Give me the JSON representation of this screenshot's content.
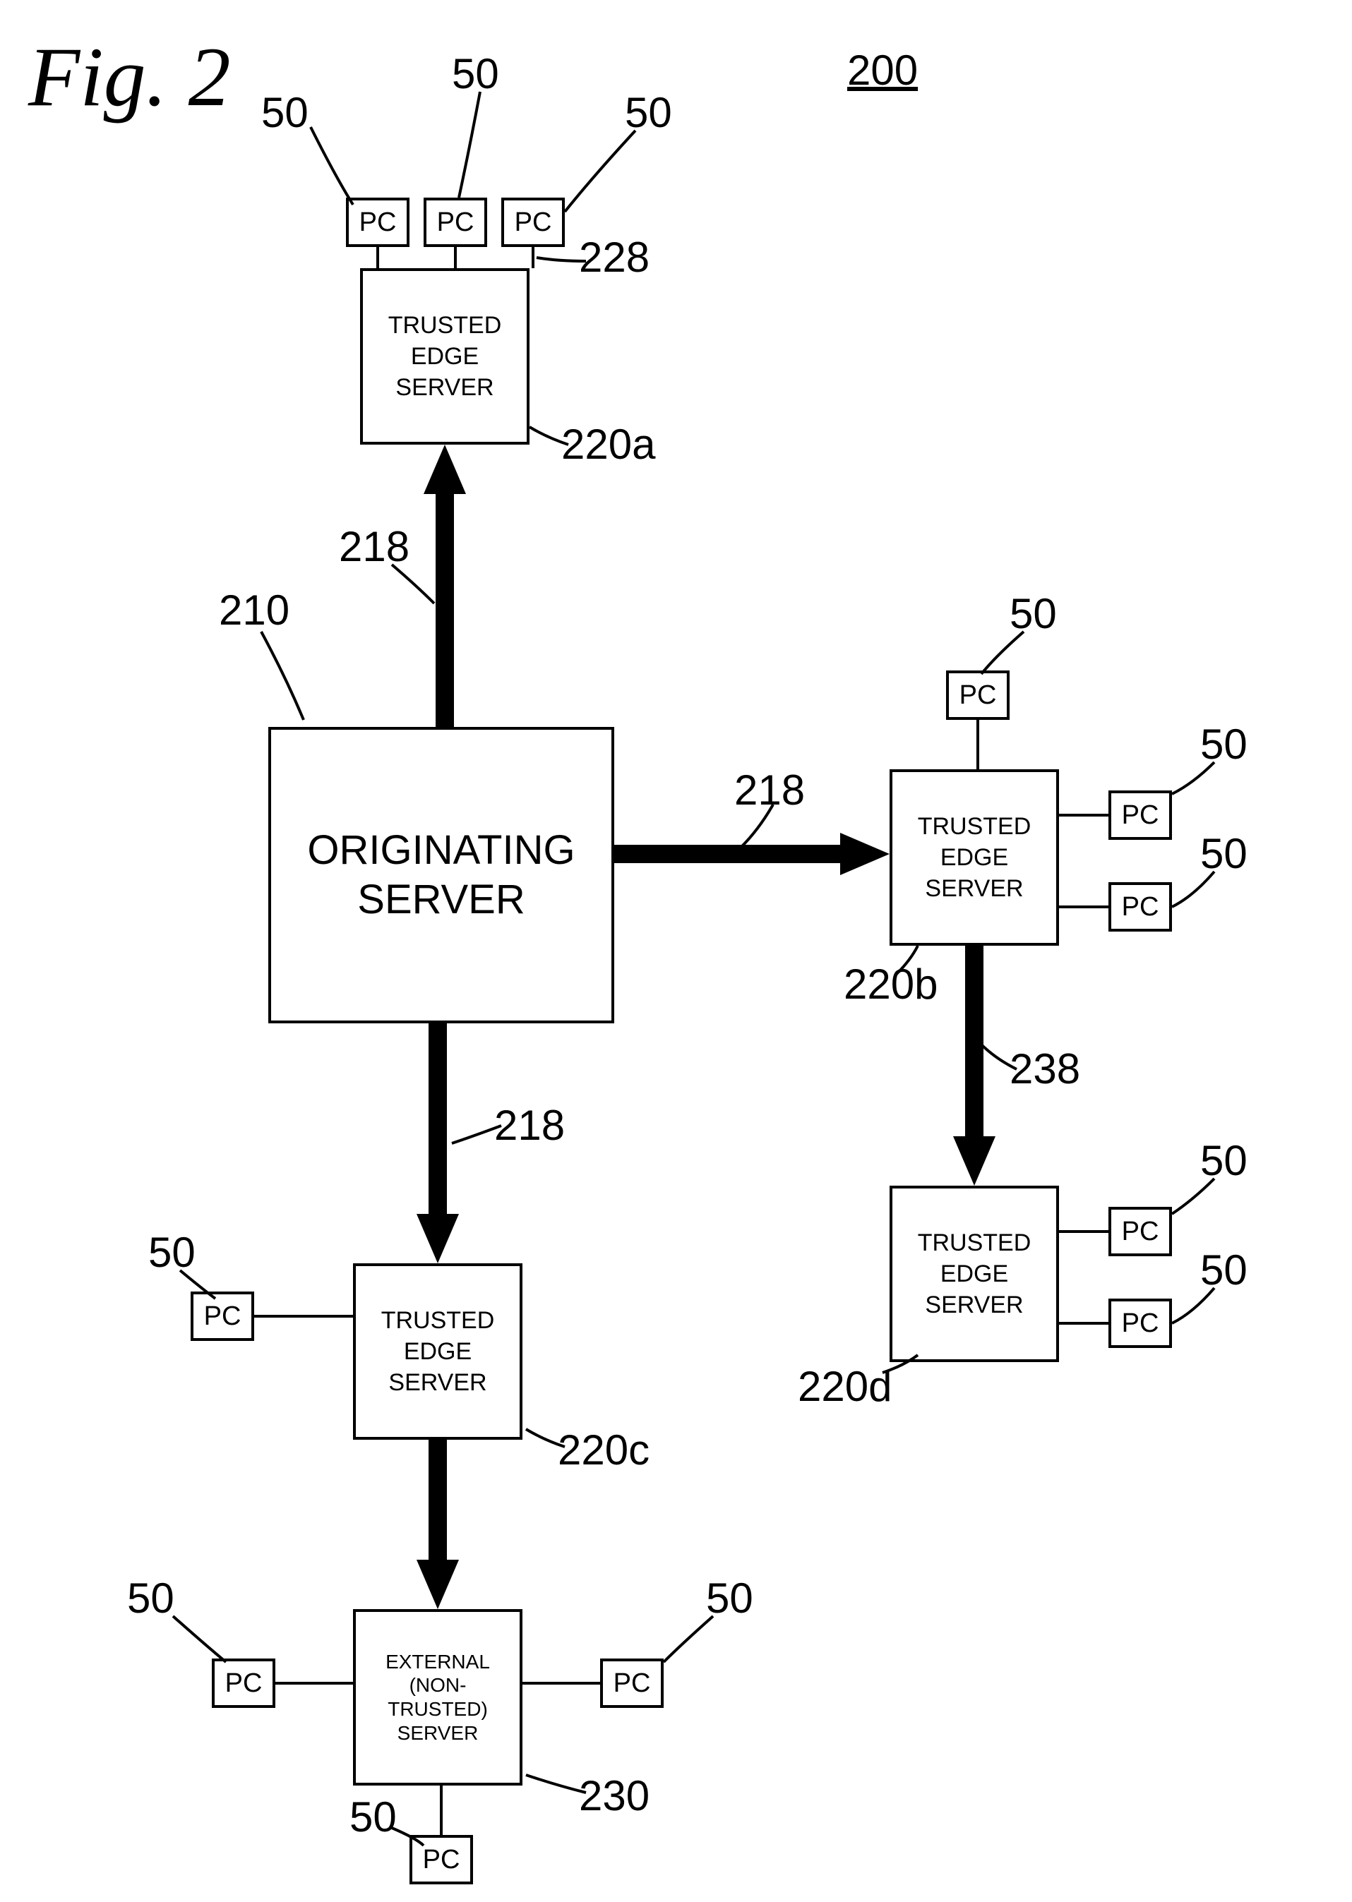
{
  "title": "Fig. 2",
  "diagram_ref": "200",
  "nodes": {
    "originating_server": "ORIGINATING SERVER",
    "trusted_edge_server": "TRUSTED EDGE SERVER",
    "external_server_line1": "EXTERNAL",
    "external_server_line2": "(NON-",
    "external_server_line3": "TRUSTED)",
    "external_server_line4": "SERVER",
    "pc": "PC"
  },
  "refs": {
    "r210": "210",
    "r218": "218",
    "r220a": "220a",
    "r220b": "220b",
    "r220c": "220c",
    "r220d": "220d",
    "r228": "228",
    "r230": "230",
    "r238": "238",
    "r50": "50"
  }
}
